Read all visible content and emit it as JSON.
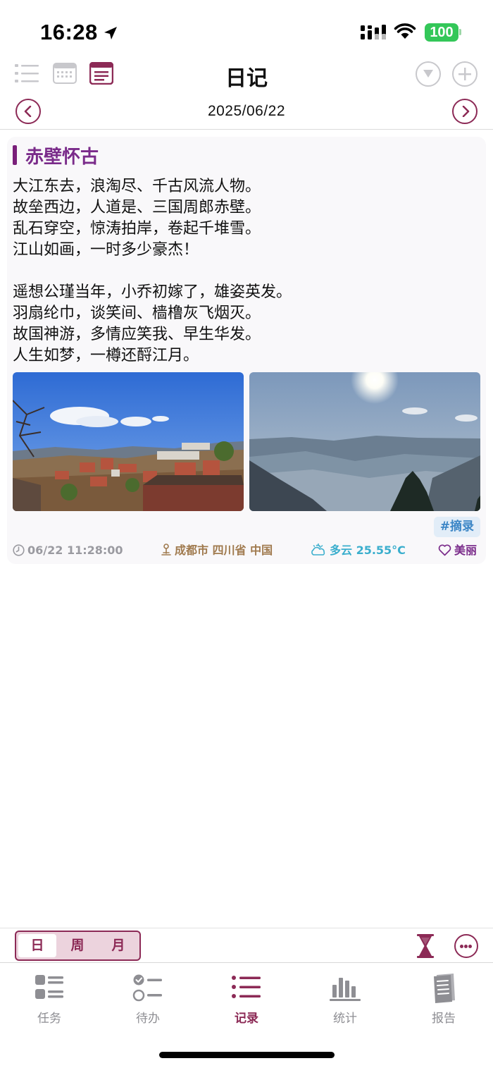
{
  "status_bar": {
    "time": "16:28",
    "battery": "100",
    "icons": [
      "location-arrow-icon",
      "cellular-signal-icon",
      "wifi-icon",
      "battery-icon"
    ]
  },
  "nav": {
    "title": "日记",
    "date": "2025/06/22",
    "view_modes": [
      "list-view-icon",
      "calendar-view-icon",
      "journal-view-icon"
    ],
    "active_view": "journal-view-icon",
    "actions": [
      "filter-dropdown-icon",
      "add-icon"
    ]
  },
  "entry": {
    "title": "赤壁怀古",
    "body": "大江东去，浪淘尽、千古风流人物。\n故垒西边，人道是、三国周郎赤壁。\n乱石穿空，惊涛拍岸，卷起千堆雪。\n江山如画，一时多少豪杰！\n\n遥想公瑾当年，小乔初嫁了，雄姿英发。\n羽扇纶巾，谈笑间、樯橹灰飞烟灭。\n故国神游，多情应笑我、早生华发。\n人生如梦，一樽还酹江月。",
    "photos": [
      "village-photo",
      "mountain-sun-photo"
    ],
    "tag": "#摘录",
    "time": "06/22 11:28:00",
    "location": "成都市 四川省 中国",
    "weather": "多云 25.55°C",
    "mood": "美丽"
  },
  "period_selector": {
    "options": [
      "日",
      "周",
      "月"
    ],
    "selected": "日"
  },
  "tabbar": {
    "items": [
      {
        "label": "任务",
        "icon": "tasks-icon"
      },
      {
        "label": "待办",
        "icon": "todo-icon"
      },
      {
        "label": "记录",
        "icon": "records-icon"
      },
      {
        "label": "统计",
        "icon": "stats-icon"
      },
      {
        "label": "报告",
        "icon": "report-icon"
      }
    ],
    "active": "记录"
  },
  "colors": {
    "accent": "#8c2a56",
    "title": "#7a2b8a",
    "tag_text": "#3c86c6",
    "tag_bg": "#e2edf8",
    "location": "#a07a4e",
    "weather": "#3aaecd",
    "mood": "#7a2b8a",
    "inactive": "#8e8e93"
  }
}
